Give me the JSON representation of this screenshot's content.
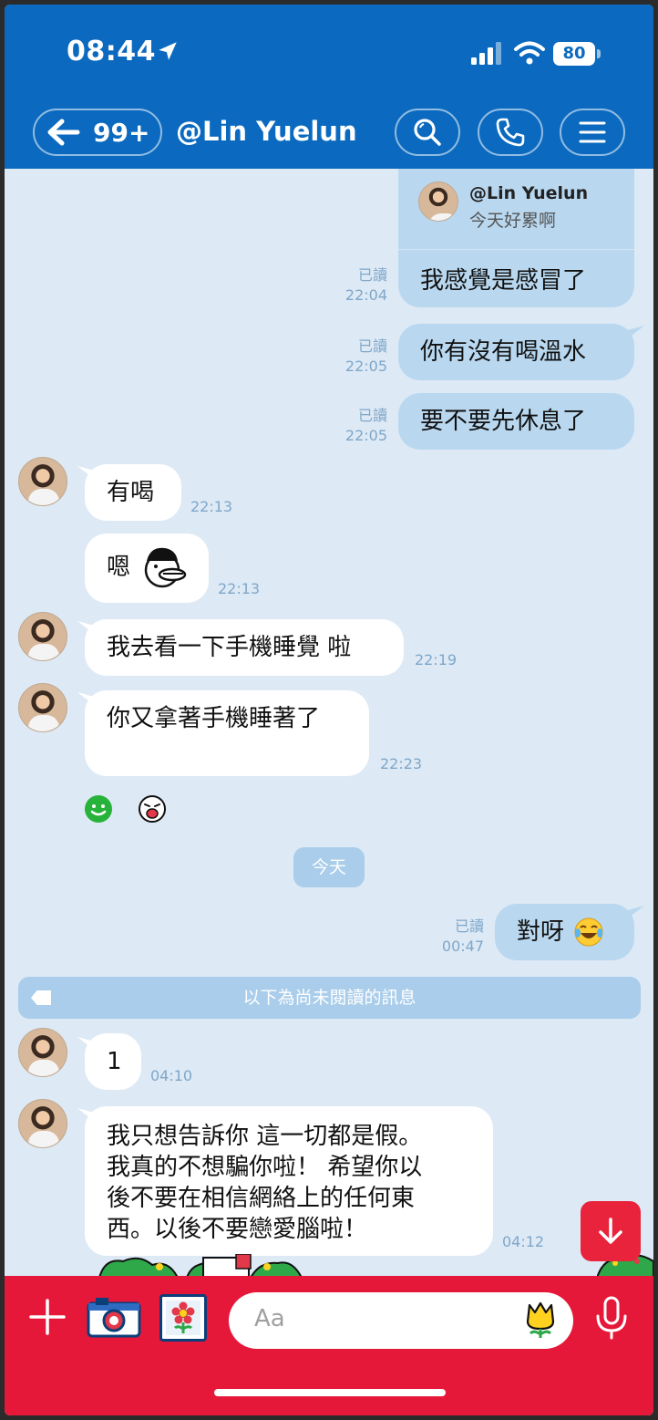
{
  "status_bar": {
    "time": "08:44",
    "battery": "80"
  },
  "header": {
    "unread_count": "99+",
    "title": "@Lin Yuelun"
  },
  "reply_preview": {
    "name": "@Lin Yuelun",
    "quoted": "今天好累啊",
    "message": "我感覺是感冒了",
    "read": "已讀",
    "time": "22:04"
  },
  "messages": [
    {
      "dir": "out",
      "text": "你有沒有喝溫水",
      "read": "已讀",
      "time": "22:05"
    },
    {
      "dir": "out",
      "text": "要不要先休息了",
      "read": "已讀",
      "time": "22:05"
    },
    {
      "dir": "in",
      "text": "有喝",
      "time": "22:13"
    },
    {
      "dir": "in",
      "text": "嗯",
      "time": "22:13"
    },
    {
      "dir": "in",
      "text": "我去看一下手機睡覺 啦",
      "time": "22:19"
    },
    {
      "dir": "in",
      "text": "你又拿著手機睡著了",
      "time": "22:23"
    },
    {
      "dir": "out",
      "text": "對呀",
      "read": "已讀",
      "time": "00:47"
    },
    {
      "dir": "in",
      "text": "1",
      "time": "04:10"
    },
    {
      "dir": "in",
      "lines": [
        "我只想告訴你  這一切都是假。",
        "我真的不想騙你啦！  希望你以",
        "後不要在相信網絡上的任何東",
        "西。以後不要戀愛腦啦！"
      ],
      "time": "04:12"
    }
  ],
  "date_divider": "今天",
  "unread_divider": "以下為尚未閱讀的訊息",
  "composer": {
    "placeholder": "Aa"
  },
  "colors": {
    "header": "#0b6abf",
    "background": "#dde9f5",
    "outgoing": "#b9d8f0",
    "bottom_bar": "#e5183a"
  }
}
